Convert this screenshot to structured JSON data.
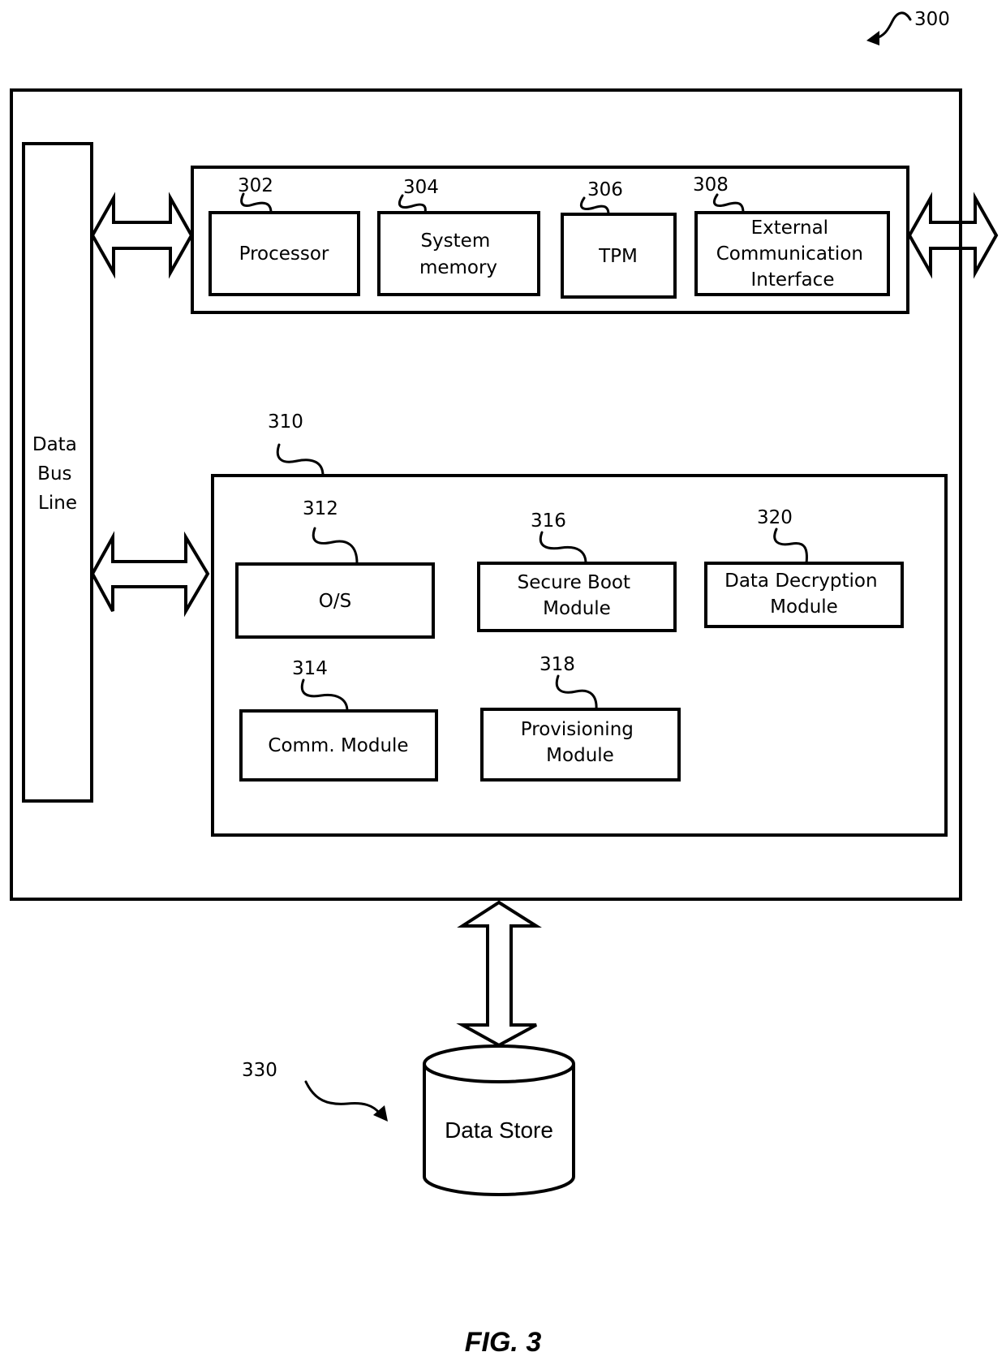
{
  "figure": {
    "caption": "FIG. 3",
    "reference": "300"
  },
  "system": {
    "data_bus": {
      "lines": [
        "Data",
        "Bus",
        "Line"
      ]
    },
    "hardware_group": {
      "components": [
        {
          "ref": "302",
          "lines": [
            "Processor"
          ]
        },
        {
          "ref": "304",
          "lines": [
            "System",
            "memory"
          ]
        },
        {
          "ref": "306",
          "lines": [
            "TPM"
          ]
        },
        {
          "ref": "308",
          "lines": [
            "External",
            "Communication",
            "Interface"
          ]
        }
      ]
    },
    "software_group": {
      "ref": "310",
      "modules": [
        {
          "ref": "312",
          "lines": [
            "O/S"
          ]
        },
        {
          "ref": "316",
          "lines": [
            "Secure Boot",
            "Module"
          ]
        },
        {
          "ref": "320",
          "lines": [
            "Data Decryption",
            "Module"
          ]
        },
        {
          "ref": "314",
          "lines": [
            "Comm. Module"
          ]
        },
        {
          "ref": "318",
          "lines": [
            "Provisioning",
            "Module"
          ]
        }
      ]
    }
  },
  "data_store": {
    "ref": "330",
    "label": "Data Store"
  }
}
